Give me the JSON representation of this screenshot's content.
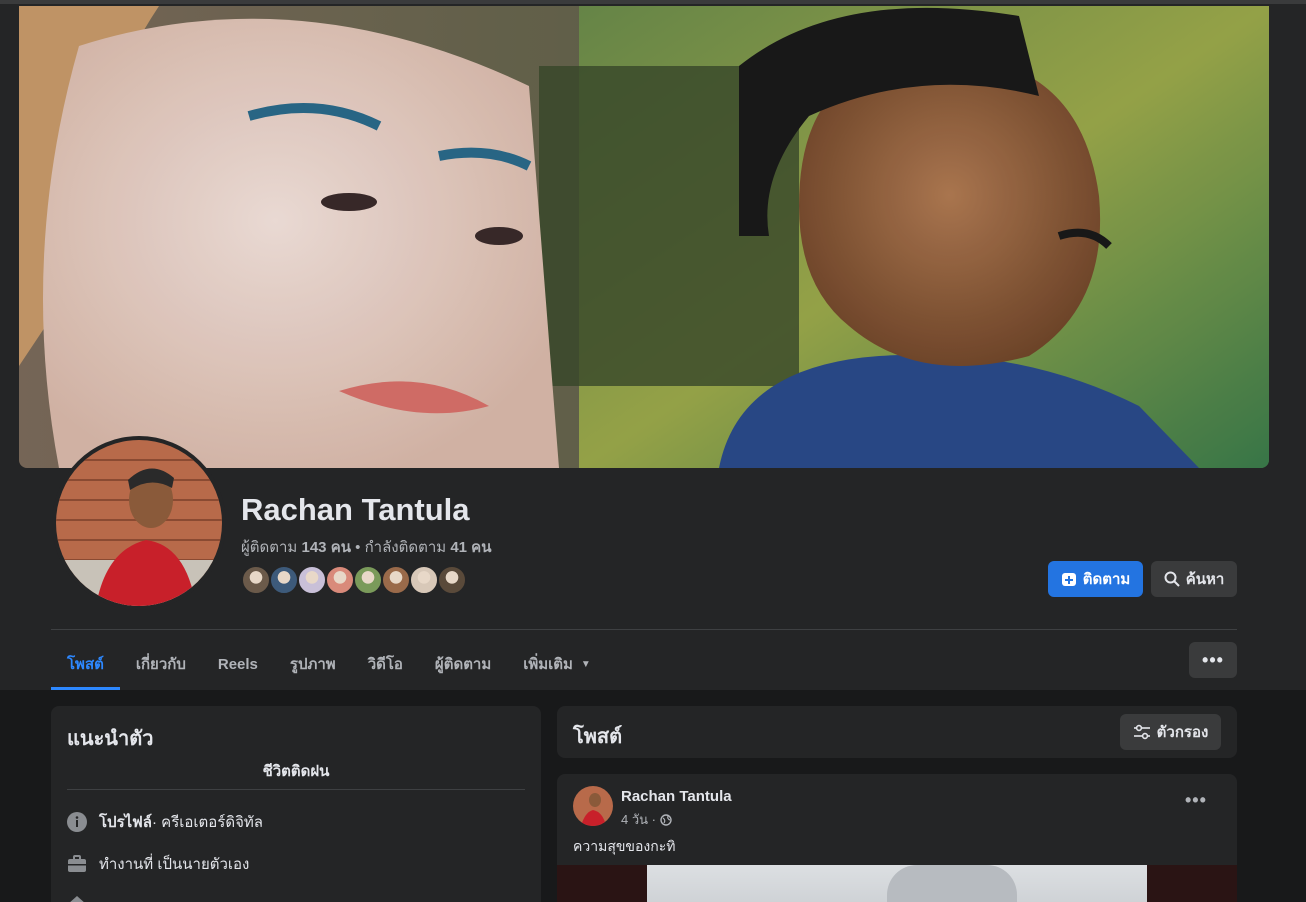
{
  "profile": {
    "name": "Rachan Tantula",
    "followers_label": "ผู้ติดตาม",
    "followers_count": "143 คน",
    "following_sep": " • กำลังติดตาม",
    "following_count": "41 คน"
  },
  "actions": {
    "follow_label": "ติดตาม",
    "search_label": "ค้นหา",
    "more_label": "•••"
  },
  "tabs": [
    {
      "label": "โพสต์",
      "active": true
    },
    {
      "label": "เกี่ยวกับ"
    },
    {
      "label": "Reels"
    },
    {
      "label": "รูปภาพ"
    },
    {
      "label": "วิดีโอ"
    },
    {
      "label": "ผู้ติดตาม"
    },
    {
      "label": "เพิ่มเติม"
    }
  ],
  "intro": {
    "title": "แนะนำตัว",
    "bio": "ชีวิตติดฝน",
    "rows": [
      {
        "icon": "info-icon",
        "bold": "โปรไฟล์",
        "text": " · ครีเอเตอร์ดิจิทัล"
      },
      {
        "icon": "briefcase-icon",
        "bold": "",
        "text": "ทำงานที่ เป็นนายตัวเอง"
      }
    ]
  },
  "posts_section": {
    "title": "โพสต์",
    "filter_label": "ตัวกรอง"
  },
  "post": {
    "author": "Rachan Tantula",
    "time": "4 วัน ·",
    "privacy_icon": "globe-icon",
    "text": "ความสุขของกะทิ",
    "menu_label": "•••"
  },
  "colors": {
    "accent": "#2374e1",
    "active_tab": "#2d88ff",
    "panel": "#242526",
    "page_bg": "#18191a"
  },
  "follower_avatar_colors": [
    "#6b5a4a",
    "#3d5a7a",
    "#c9c0d8",
    "#d98a7a",
    "#7a9a5a",
    "#9a6a4a",
    "#d8c8b8",
    "#5a4a3a"
  ]
}
